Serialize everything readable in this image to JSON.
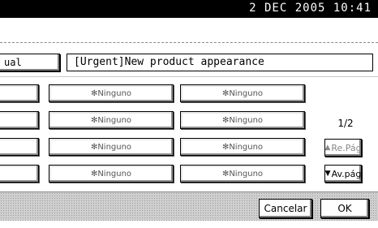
{
  "status_bar": {
    "datetime": "2 DEC  2005 10:41"
  },
  "subject": {
    "manual_label": "ual",
    "value": "[Urgent]New product appearance"
  },
  "grid": {
    "rows": [
      {
        "col0": "",
        "col1": "✻Ninguno",
        "col2": "✻Ninguno"
      },
      {
        "col0": "",
        "col1": "✻Ninguno",
        "col2": "✻Ninguno"
      },
      {
        "col0": "",
        "col1": "✻Ninguno",
        "col2": "✻Ninguno"
      },
      {
        "col0": "",
        "col1": "✻Ninguno",
        "col2": "✻Ninguno"
      }
    ]
  },
  "pagination": {
    "indicator": "1/2",
    "prev_label": "Re.Pág",
    "next_label": "Av.pág",
    "prev_icon": "triangle-up-icon",
    "next_icon": "triangle-down-icon"
  },
  "footer": {
    "cancel_label": "Cancelar",
    "ok_label": "OK"
  }
}
